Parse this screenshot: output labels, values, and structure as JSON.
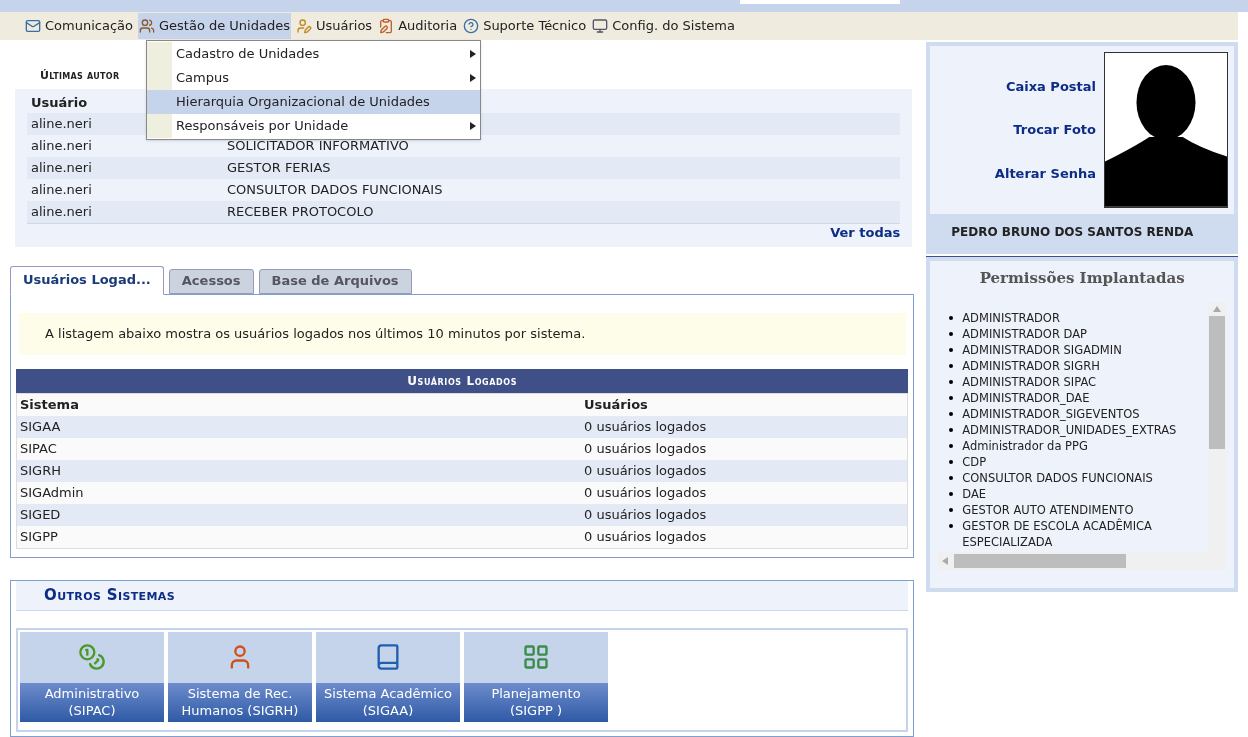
{
  "menu_bar": [
    {
      "kind": "mail",
      "label": "Comunicação",
      "selected": false
    },
    {
      "kind": "units",
      "label": "Gestão de Unidades",
      "selected": true
    },
    {
      "kind": "users",
      "label": "Usuários",
      "selected": false
    },
    {
      "kind": "audit",
      "label": "Auditoria",
      "selected": false
    },
    {
      "kind": "help",
      "label": "Suporte Técnico",
      "selected": false
    },
    {
      "kind": "config",
      "label": "Config. do Sistema",
      "selected": false
    }
  ],
  "dropdown": [
    {
      "label": "Cadastro de Unidades",
      "submenu": true,
      "selected": false
    },
    {
      "label": "Campus",
      "submenu": true,
      "selected": false
    },
    {
      "label": "Hierarquia Organizacional de Unidades",
      "submenu": false,
      "selected": true
    },
    {
      "label": "Responsáveis por Unidade",
      "submenu": true,
      "selected": false
    }
  ],
  "authorizations": {
    "title": "Últimas autor",
    "column_1": "Usuário",
    "rows": [
      {
        "user": "aline.neri"
      },
      {
        "user": "aline.neri",
        "column_2": "SOLICITADOR INFORMATIVO"
      },
      {
        "user": "aline.neri",
        "column_2": "GESTOR FERIAS"
      },
      {
        "user": "aline.neri",
        "column_2": "CONSULTOR DADOS FUNCIONAIS"
      },
      {
        "user": "aline.neri",
        "column_2": "RECEBER PROTOCOLO"
      }
    ],
    "link": "Ver todas"
  },
  "tabs": [
    {
      "label": "Usuários Logad...",
      "selected": true
    },
    {
      "label": "Acessos",
      "selected": false
    },
    {
      "label": "Base de Arquivos",
      "selected": false
    }
  ],
  "notice": "A listagem abaixo mostra os usuários logados nos últimos 10 minutos por sistema.",
  "logged_table": {
    "title": "Usuários Logados",
    "columns": [
      "Sistema",
      "Usuários"
    ],
    "rows": [
      [
        "SIGAA",
        "0 usuários logados"
      ],
      [
        "SIPAC",
        "0 usuários logados"
      ],
      [
        "SIGRH",
        "0 usuários logados"
      ],
      [
        "SIGAdmin",
        "0 usuários logados"
      ],
      [
        "SIGED",
        "0 usuários logados"
      ],
      [
        "SIGPP",
        "0 usuários logados"
      ]
    ]
  },
  "other_systems": {
    "title": "Outros Sistemas",
    "items": [
      {
        "kind": "money",
        "line_1": "Administrativo",
        "line_2": "(SIPAC)"
      },
      {
        "kind": "person",
        "line_1": "Sistema de Rec.",
        "line_2": "Humanos (SIGRH)"
      },
      {
        "kind": "book",
        "line_1": "Sistema Acadêmico",
        "line_2": "(SIGAA)"
      },
      {
        "kind": "grid",
        "line_1": "Planejamento",
        "line_2": "(SIGPP )"
      }
    ]
  },
  "profile": {
    "links": [
      "Caixa Postal",
      "Trocar Foto",
      "Alterar Senha"
    ],
    "name": "PEDRO BRUNO DOS SANTOS RENDA"
  },
  "permissions": {
    "title": "Permissões Implantadas",
    "items": [
      "ADMINISTRADOR",
      "ADMINISTRADOR DAP",
      "ADMINISTRADOR SIGADMIN",
      "ADMINISTRADOR SIGRH",
      "ADMINISTRADOR SIPAC",
      "ADMINISTRADOR_DAE",
      "ADMINISTRADOR_SIGEVENTOS",
      "ADMINISTRADOR_UNIDADES_EXTRAS",
      "Administrador da PPG",
      "CDP",
      "CONSULTOR DADOS FUNCIONAIS",
      "DAE",
      "GESTOR AUTO ATENDIMENTO",
      "GESTOR DE ESCOLA ACADÊMICA ESPECIALIZADA"
    ]
  }
}
